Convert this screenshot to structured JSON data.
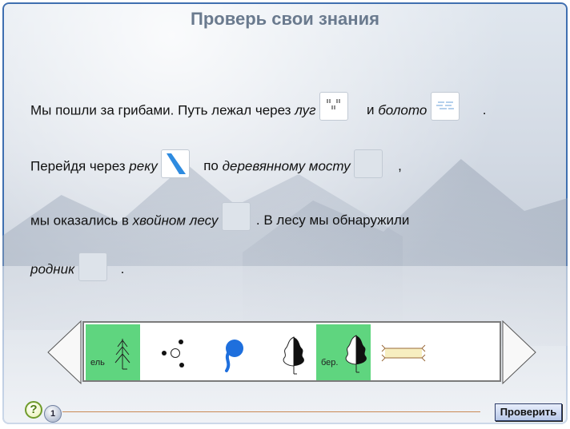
{
  "title": "Проверь свои знания",
  "text": {
    "line1_a": "Мы пошли за грибами. Путь лежал через ",
    "line1_lug": "луг",
    "line1_b": " и ",
    "line1_boloto": "болото",
    "line1_end": ".",
    "line2_a": "Перейдя через ",
    "line2_reka": "реку",
    "line2_b": " по ",
    "line2_most": "деревянному мосту",
    "line2_end": ",",
    "line3_a": "мы оказались в ",
    "line3_les": "хвойном лесу",
    "line3_b": ". В лесу мы обнаружили",
    "line4_rodnik": "родник",
    "line4_end": "."
  },
  "palette": {
    "tile_el_label": "ель",
    "tile_ber_label": "бер."
  },
  "footer": {
    "help_symbol": "?",
    "page_number": "1",
    "check_label": "Проверить"
  },
  "colors": {
    "tile_green": "#5fd57f",
    "title": "#6a7a8e",
    "frame_border": "#3f6fb0"
  }
}
